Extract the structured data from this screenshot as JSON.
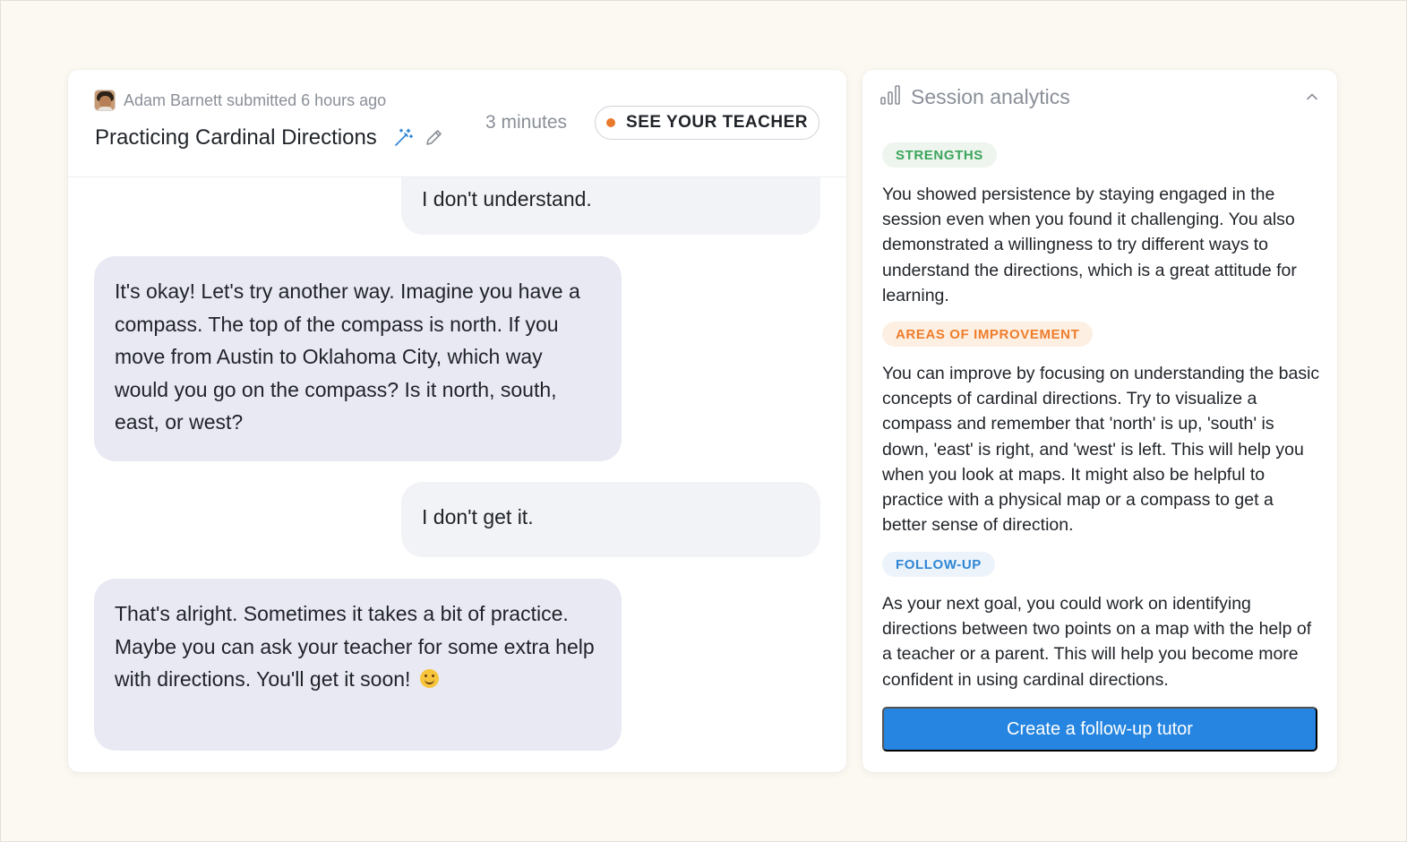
{
  "chat": {
    "submitter_text": "Adam Barnett submitted 6 hours ago",
    "title": "Practicing Cardinal Directions",
    "duration": "3 minutes",
    "teacher_button": "SEE YOUR TEACHER",
    "messages": [
      {
        "role": "user",
        "text": "I don't understand."
      },
      {
        "role": "bot",
        "text": "It's okay! Let's try another way. Imagine you have a compass. The top of the compass is north. If you move from Austin to Oklahoma City, which way would you go on the compass? Is it north, south, east, or west?"
      },
      {
        "role": "user",
        "text": "I don't get it."
      },
      {
        "role": "bot",
        "text": "That's alright. Sometimes it takes a bit of practice. Maybe you can ask your teacher for some extra help with directions. You'll get it soon!"
      }
    ]
  },
  "analytics": {
    "title": "Session analytics",
    "strengths": {
      "label": "STRENGTHS",
      "text": "You showed persistence by staying engaged in the session even when you found it challenging. You also demonstrated a willingness to try different ways to understand the directions, which is a great attitude for learning."
    },
    "improvement": {
      "label": "AREAS OF IMPROVEMENT",
      "text": "You can improve by focusing on understanding the basic concepts of cardinal directions. Try to visualize a compass and remember that 'north' is up, 'south' is down, 'east' is right, and 'west' is left. This will help you when you look at maps. It might also be helpful to practice with a physical map or a compass to get a better sense of direction."
    },
    "followup": {
      "label": "FOLLOW-UP",
      "text": "As your next goal, you could work on identifying directions between two points on a map with the help of a teacher or a parent. This will help you become more confident in using cardinal directions."
    },
    "cta_label": "Create a follow-up tutor"
  },
  "colors": {
    "accent": "#2585e0",
    "status_dot": "#ea7a2b",
    "strengths": "#3aa55b",
    "improvement": "#ee7d2c",
    "followup": "#2f86d4"
  },
  "icons": [
    "magic-wand-icon",
    "pencil-icon",
    "bar-chart-icon",
    "chevron-up-icon",
    "smiling-face-emoji"
  ]
}
